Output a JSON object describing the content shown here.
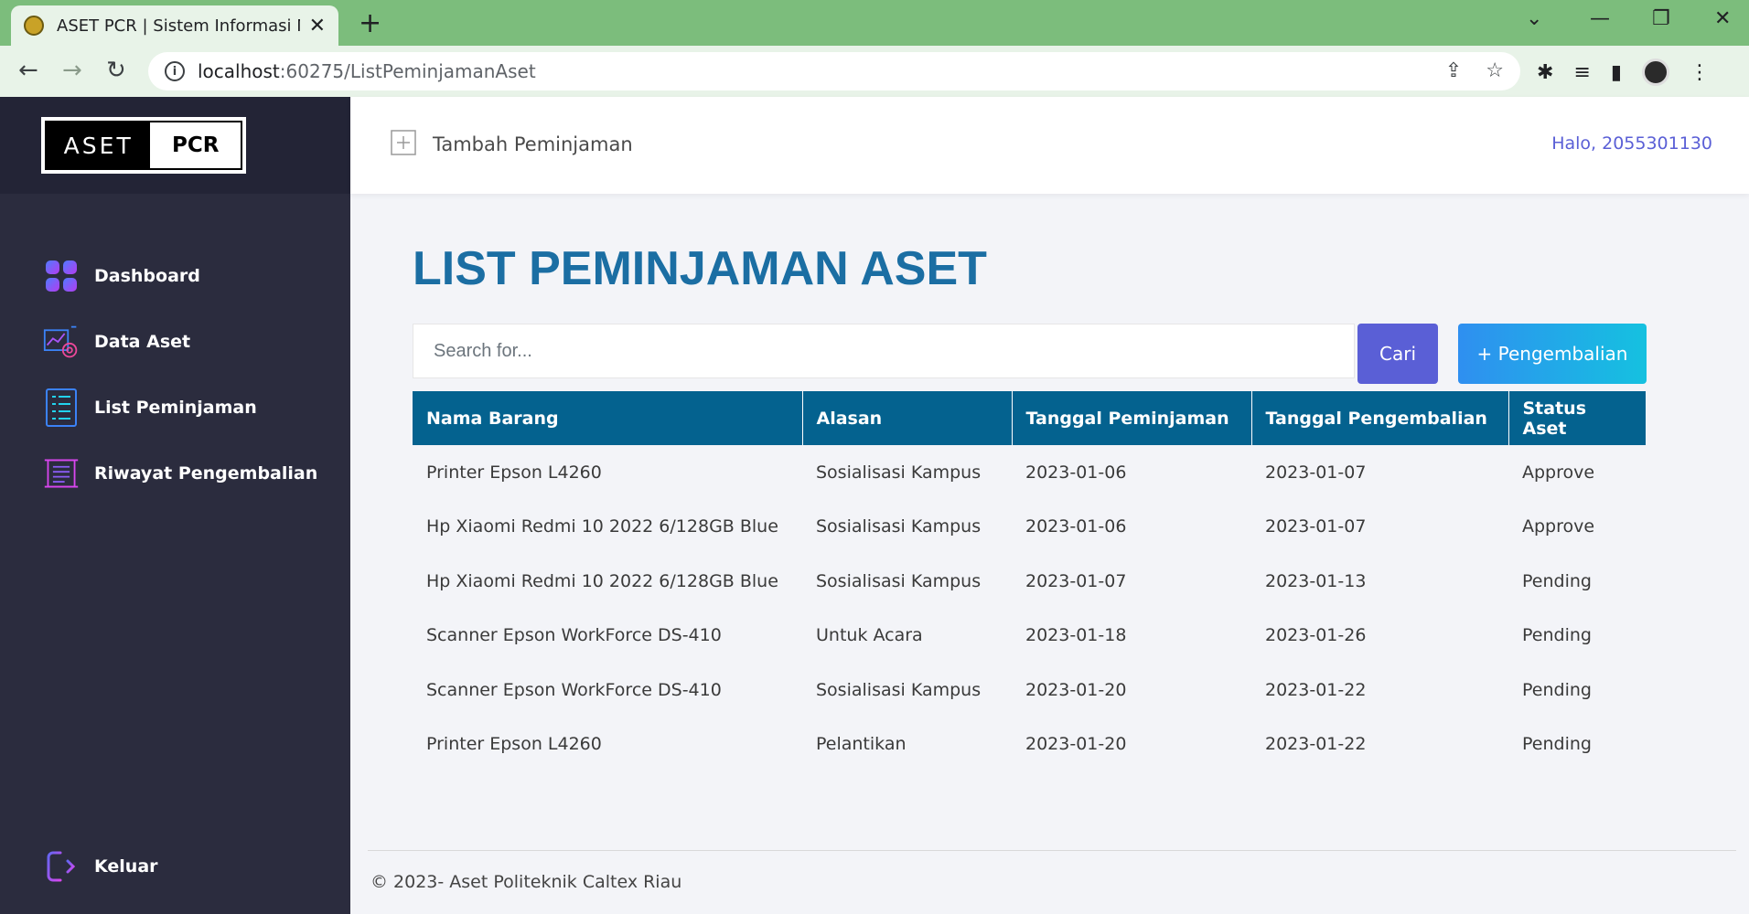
{
  "browser": {
    "tab_title": "ASET PCR | Sistem Informasi Man",
    "url_host": "localhost",
    "url_path": ":60275/ListPeminjamanAset"
  },
  "sidebar": {
    "logo_left": "ASET",
    "logo_right": "PCR",
    "items": [
      {
        "label": "Dashboard",
        "icon": "dashboard-icon"
      },
      {
        "label": "Data Aset",
        "icon": "data-aset-icon"
      },
      {
        "label": "List Peminjaman",
        "icon": "list-icon"
      },
      {
        "label": "Riwayat Pengembalian",
        "icon": "history-icon"
      }
    ],
    "logout_label": "Keluar"
  },
  "header": {
    "add_loan_label": "Tambah Peminjaman",
    "greeting": "Halo, 2055301130"
  },
  "main": {
    "title": "LIST PEMINJAMAN ASET",
    "search_placeholder": "Search for...",
    "search_button": "Cari",
    "return_button": "+ Pengembalian"
  },
  "table": {
    "columns": [
      "Nama Barang",
      "Alasan",
      "Tanggal Peminjaman",
      "Tanggal Pengembalian",
      "Status Aset"
    ],
    "rows": [
      [
        "Printer Epson L4260",
        "Sosialisasi Kampus",
        "2023-01-06",
        "2023-01-07",
        "Approve"
      ],
      [
        "Hp Xiaomi Redmi 10 2022 6/128GB Blue",
        "Sosialisasi Kampus",
        "2023-01-06",
        "2023-01-07",
        "Approve"
      ],
      [
        "Hp Xiaomi Redmi 10 2022 6/128GB Blue",
        "Sosialisasi Kampus",
        "2023-01-07",
        "2023-01-13",
        "Pending"
      ],
      [
        "Scanner Epson WorkForce DS-410",
        "Untuk Acara",
        "2023-01-18",
        "2023-01-26",
        "Pending"
      ],
      [
        "Scanner Epson WorkForce DS-410",
        "Sosialisasi Kampus",
        "2023-01-20",
        "2023-01-22",
        "Pending"
      ],
      [
        "Printer Epson L4260",
        "Pelantikan",
        "2023-01-20",
        "2023-01-22",
        "Pending"
      ]
    ]
  },
  "footer": {
    "text": "© 2023- Aset Politeknik Caltex Riau"
  },
  "colors": {
    "sidebar_bg": "#2b2c3e",
    "title": "#1b6ea3",
    "table_header": "#04628f",
    "button_primary": "#5a5fd6",
    "tab_bar": "#7cbd7c"
  }
}
